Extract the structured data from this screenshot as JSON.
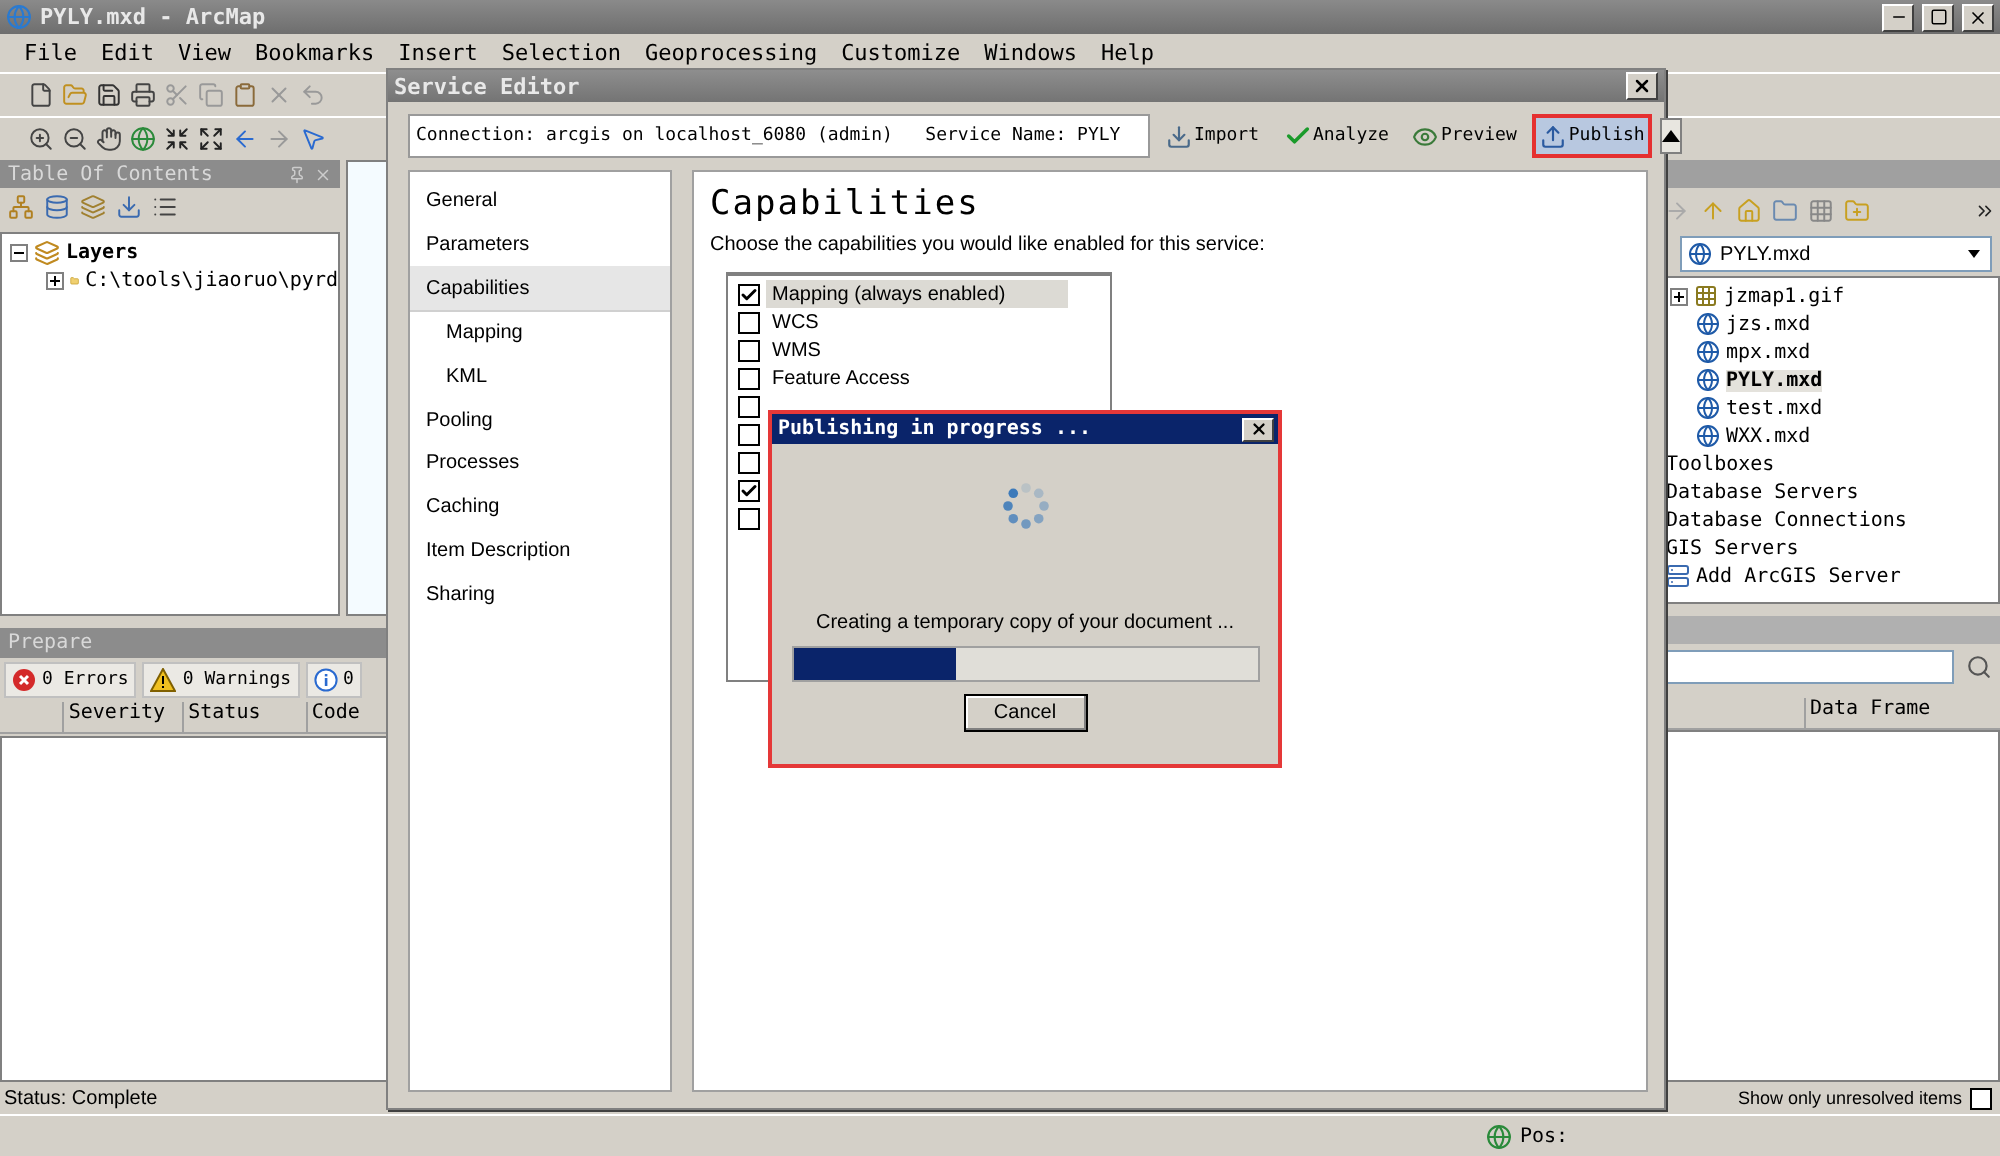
{
  "window": {
    "title": "PYLY.mxd - ArcMap"
  },
  "menu": [
    "File",
    "Edit",
    "View",
    "Bookmarks",
    "Insert",
    "Selection",
    "Geoprocessing",
    "Customize",
    "Windows",
    "Help"
  ],
  "toc": {
    "title": "Table Of Contents",
    "tree": [
      {
        "label": "Layers",
        "expanded": true,
        "children": [
          {
            "label": "C:\\tools\\jiaoruo\\pyrd",
            "expanded": false
          }
        ]
      }
    ]
  },
  "prepare": {
    "title": "Prepare",
    "tabs": [
      {
        "kind": "error",
        "label": "0 Errors"
      },
      {
        "kind": "warning",
        "label": "0 Warnings"
      },
      {
        "kind": "info",
        "label": "0"
      }
    ],
    "columns": [
      "Severity",
      "Status",
      "Code"
    ],
    "status": "Status: Complete"
  },
  "catalog": {
    "location": "PYLY.mxd",
    "tree": [
      {
        "children": [
          {
            "label": "jzmap1.gif",
            "kind": "image",
            "expanded": false,
            "selected": false
          },
          {
            "label": "jzs.mxd",
            "kind": "map",
            "selected": false
          },
          {
            "label": "mpx.mxd",
            "kind": "map",
            "selected": false
          },
          {
            "label": "PYLY.mxd",
            "kind": "map",
            "selected": true
          },
          {
            "label": "test.mxd",
            "kind": "map",
            "selected": false
          },
          {
            "label": "WXX.mxd",
            "kind": "map",
            "selected": false
          }
        ]
      },
      {
        "label": "Toolboxes",
        "kind": "plain",
        "selected": false
      },
      {
        "label": "Database Servers",
        "kind": "plain",
        "selected": false
      },
      {
        "label": "Database Connections",
        "kind": "plain",
        "selected": false
      },
      {
        "label": "GIS Servers",
        "kind": "plain",
        "selected": false
      },
      {
        "label": "Add ArcGIS Server",
        "kind": "add",
        "selected": false
      }
    ]
  },
  "results": {
    "columns": [
      "Data Frame"
    ],
    "filter": {
      "label": "Show only unresolved items",
      "checked": false
    }
  },
  "status_bar": {
    "position": "Pos:"
  },
  "service_editor": {
    "title": "Service Editor",
    "connection": "Connection: arcgis on localhost_6080 (admin)   Service Name: PYLY",
    "actions": [
      {
        "kind": "import",
        "label": "Import",
        "highlighted": false
      },
      {
        "kind": "analyze",
        "label": "Analyze",
        "highlighted": false
      },
      {
        "kind": "preview",
        "label": "Preview",
        "highlighted": false
      },
      {
        "kind": "publish",
        "label": "Publish",
        "highlighted": true
      }
    ],
    "nav": [
      {
        "label": "General",
        "selected": false
      },
      {
        "label": "Parameters",
        "selected": false
      },
      {
        "label": "Capabilities",
        "selected": true,
        "children": [
          {
            "label": "Mapping",
            "selected": false
          },
          {
            "label": "KML",
            "selected": false
          }
        ]
      },
      {
        "label": "Pooling",
        "selected": false
      },
      {
        "label": "Processes",
        "selected": false
      },
      {
        "label": "Caching",
        "selected": false
      },
      {
        "label": "Item Description",
        "selected": false
      },
      {
        "label": "Sharing",
        "selected": false
      }
    ],
    "heading": "Capabilities",
    "description": "Choose the capabilities you would like enabled for this service:",
    "capabilities": [
      {
        "label": "Mapping (always enabled)",
        "checked": true,
        "selected": true
      },
      {
        "label": "WCS",
        "checked": false,
        "selected": false
      },
      {
        "label": "WMS",
        "checked": false,
        "selected": false
      },
      {
        "label": "Feature Access",
        "checked": false,
        "selected": false
      },
      {
        "checked": false,
        "selected": false
      },
      {
        "checked": false,
        "selected": false
      },
      {
        "checked": false,
        "selected": false
      },
      {
        "checked": true,
        "selected": false
      },
      {
        "checked": false,
        "selected": false
      }
    ]
  },
  "progress_dialog": {
    "title": "Publishing in progress ...",
    "message": "Creating a temporary copy of your document ...",
    "level": 0.35,
    "button": "Cancel"
  }
}
